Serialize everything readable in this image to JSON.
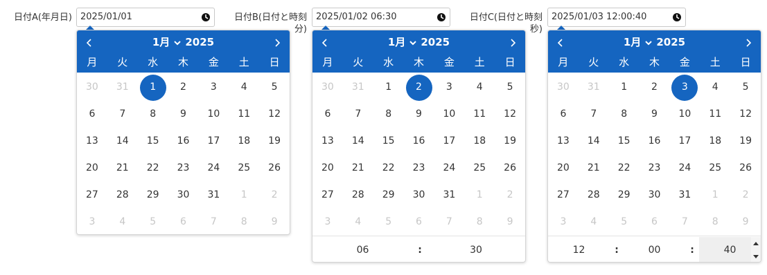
{
  "pickers": [
    {
      "label_lines": [
        "日付A(年月日)"
      ],
      "value": "2025/01/01",
      "month": "1月",
      "year": "2025",
      "weekdays": [
        "月",
        "火",
        "水",
        "木",
        "金",
        "土",
        "日"
      ],
      "weeks": [
        [
          "30",
          "31",
          "1",
          "2",
          "3",
          "4",
          "5"
        ],
        [
          "6",
          "7",
          "8",
          "9",
          "10",
          "11",
          "12"
        ],
        [
          "13",
          "14",
          "15",
          "16",
          "17",
          "18",
          "19"
        ],
        [
          "20",
          "21",
          "22",
          "23",
          "24",
          "25",
          "26"
        ],
        [
          "27",
          "28",
          "29",
          "30",
          "31",
          "1",
          "2"
        ],
        [
          "3",
          "4",
          "5",
          "6",
          "7",
          "8",
          "9"
        ]
      ],
      "selected": "1",
      "time": []
    },
    {
      "label_lines": [
        "日付B(日付と時刻",
        "分)"
      ],
      "value": "2025/01/02 06:30",
      "month": "1月",
      "year": "2025",
      "weekdays": [
        "月",
        "火",
        "水",
        "木",
        "金",
        "土",
        "日"
      ],
      "weeks": [
        [
          "30",
          "31",
          "1",
          "2",
          "3",
          "4",
          "5"
        ],
        [
          "6",
          "7",
          "8",
          "9",
          "10",
          "11",
          "12"
        ],
        [
          "13",
          "14",
          "15",
          "16",
          "17",
          "18",
          "19"
        ],
        [
          "20",
          "21",
          "22",
          "23",
          "24",
          "25",
          "26"
        ],
        [
          "27",
          "28",
          "29",
          "30",
          "31",
          "1",
          "2"
        ],
        [
          "3",
          "4",
          "5",
          "6",
          "7",
          "8",
          "9"
        ]
      ],
      "selected": "2",
      "time": [
        "06",
        "30"
      ]
    },
    {
      "label_lines": [
        "日付C(日付と時刻",
        "秒)"
      ],
      "value": "2025/01/03 12:00:40",
      "month": "1月",
      "year": "2025",
      "weekdays": [
        "月",
        "火",
        "水",
        "木",
        "金",
        "土",
        "日"
      ],
      "weeks": [
        [
          "30",
          "31",
          "1",
          "2",
          "3",
          "4",
          "5"
        ],
        [
          "6",
          "7",
          "8",
          "9",
          "10",
          "11",
          "12"
        ],
        [
          "13",
          "14",
          "15",
          "16",
          "17",
          "18",
          "19"
        ],
        [
          "20",
          "21",
          "22",
          "23",
          "24",
          "25",
          "26"
        ],
        [
          "27",
          "28",
          "29",
          "30",
          "31",
          "1",
          "2"
        ],
        [
          "3",
          "4",
          "5",
          "6",
          "7",
          "8",
          "9"
        ]
      ],
      "selected": "3",
      "time": [
        "12",
        "00",
        "40"
      ]
    }
  ],
  "time_separator": ":",
  "colors": {
    "accent": "#1565c0",
    "muted_day": "#c6c6c6",
    "text": "#333333"
  },
  "icons": {
    "input_icon": "clock-icon",
    "prev": "chevron-left-icon",
    "next": "chevron-right-icon",
    "month_dropdown": "chevron-down-icon"
  }
}
